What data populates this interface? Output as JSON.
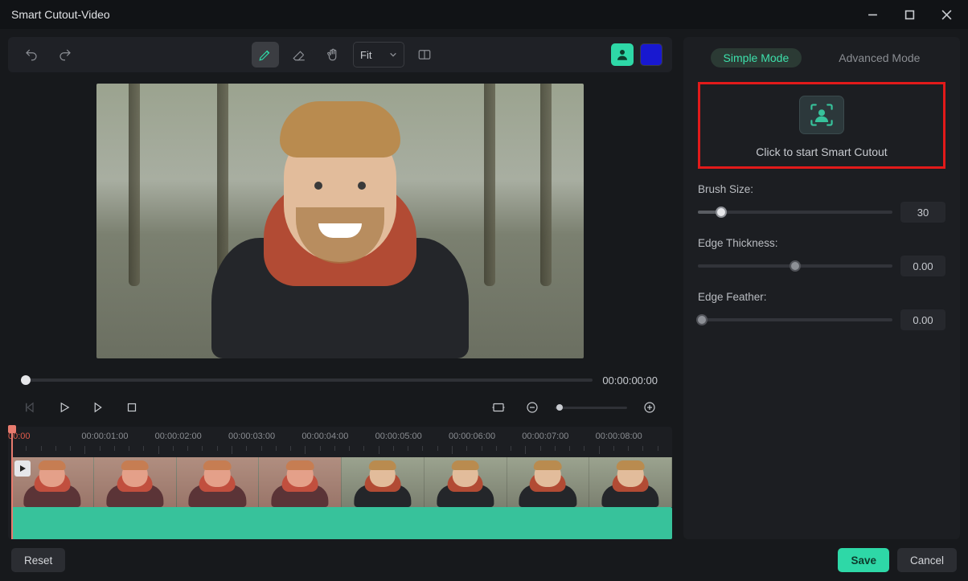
{
  "window": {
    "title": "Smart Cutout-Video"
  },
  "toolbar": {
    "fit_label": "Fit"
  },
  "playback": {
    "timecode": "00:00:00:00"
  },
  "timeline": {
    "labels": [
      "00:00",
      "00:00:01:00",
      "00:00:02:00",
      "00:00:03:00",
      "00:00:04:00",
      "00:00:05:00",
      "00:00:06:00",
      "00:00:07:00",
      "00:00:08:00"
    ]
  },
  "panel": {
    "modes": {
      "simple": "Simple Mode",
      "advanced": "Advanced Mode"
    },
    "cutout_label": "Click to start Smart Cutout",
    "brush": {
      "label": "Brush Size:",
      "value": "30",
      "pct": 12
    },
    "edge_thickness": {
      "label": "Edge Thickness:",
      "value": "0.00",
      "pct": 50
    },
    "edge_feather": {
      "label": "Edge Feather:",
      "value": "0.00",
      "pct": 2
    }
  },
  "footer": {
    "reset": "Reset",
    "save": "Save",
    "cancel": "Cancel"
  }
}
